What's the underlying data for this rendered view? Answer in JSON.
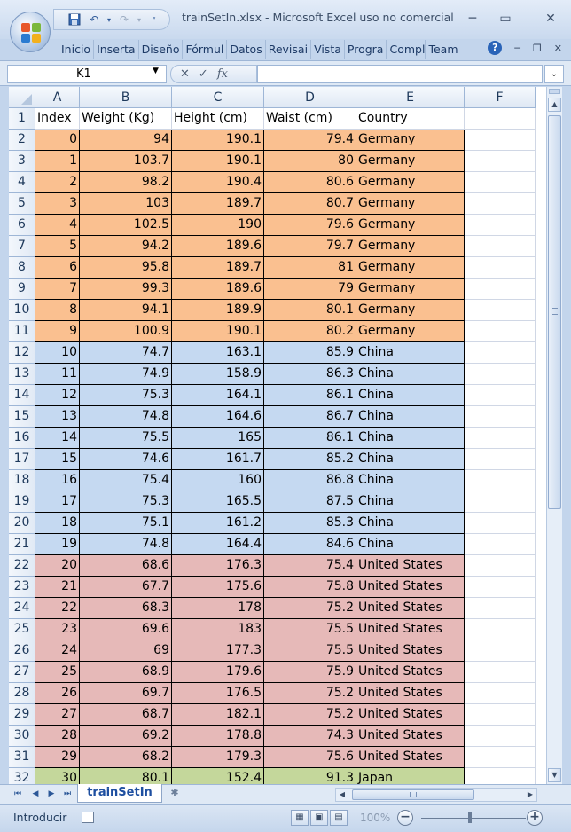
{
  "window": {
    "title": "trainSetIn.xlsx - Microsoft Excel uso no comercial",
    "minimize": "─",
    "maximize": "▭",
    "close": "✕"
  },
  "ribbon": {
    "tabs": [
      "Inicio",
      "Inserta",
      "Diseño",
      "Fórmul",
      "Datos",
      "Revisai",
      "Vista",
      "Progra",
      "Compl",
      "Team"
    ]
  },
  "formula_bar": {
    "name_box": "K1",
    "formula": ""
  },
  "sheet": {
    "columns": [
      "A",
      "B",
      "C",
      "D",
      "E",
      "F"
    ],
    "headers": [
      "Index",
      "Weight (Kg)",
      "Height (cm)",
      "Waist (cm)",
      "Country"
    ],
    "rows": [
      {
        "n": "2",
        "cells": [
          "0",
          "94",
          "190.1",
          "79.4",
          "Germany"
        ],
        "group": "de"
      },
      {
        "n": "3",
        "cells": [
          "1",
          "103.7",
          "190.1",
          "80",
          "Germany"
        ],
        "group": "de"
      },
      {
        "n": "4",
        "cells": [
          "2",
          "98.2",
          "190.4",
          "80.6",
          "Germany"
        ],
        "group": "de"
      },
      {
        "n": "5",
        "cells": [
          "3",
          "103",
          "189.7",
          "80.7",
          "Germany"
        ],
        "group": "de"
      },
      {
        "n": "6",
        "cells": [
          "4",
          "102.5",
          "190",
          "79.6",
          "Germany"
        ],
        "group": "de"
      },
      {
        "n": "7",
        "cells": [
          "5",
          "94.2",
          "189.6",
          "79.7",
          "Germany"
        ],
        "group": "de"
      },
      {
        "n": "8",
        "cells": [
          "6",
          "95.8",
          "189.7",
          "81",
          "Germany"
        ],
        "group": "de"
      },
      {
        "n": "9",
        "cells": [
          "7",
          "99.3",
          "189.6",
          "79",
          "Germany"
        ],
        "group": "de"
      },
      {
        "n": "10",
        "cells": [
          "8",
          "94.1",
          "189.9",
          "80.1",
          "Germany"
        ],
        "group": "de"
      },
      {
        "n": "11",
        "cells": [
          "9",
          "100.9",
          "190.1",
          "80.2",
          "Germany"
        ],
        "group": "de"
      },
      {
        "n": "12",
        "cells": [
          "10",
          "74.7",
          "163.1",
          "85.9",
          "China"
        ],
        "group": "cn"
      },
      {
        "n": "13",
        "cells": [
          "11",
          "74.9",
          "158.9",
          "86.3",
          "China"
        ],
        "group": "cn"
      },
      {
        "n": "14",
        "cells": [
          "12",
          "75.3",
          "164.1",
          "86.1",
          "China"
        ],
        "group": "cn"
      },
      {
        "n": "15",
        "cells": [
          "13",
          "74.8",
          "164.6",
          "86.7",
          "China"
        ],
        "group": "cn"
      },
      {
        "n": "16",
        "cells": [
          "14",
          "75.5",
          "165",
          "86.1",
          "China"
        ],
        "group": "cn"
      },
      {
        "n": "17",
        "cells": [
          "15",
          "74.6",
          "161.7",
          "85.2",
          "China"
        ],
        "group": "cn"
      },
      {
        "n": "18",
        "cells": [
          "16",
          "75.4",
          "160",
          "86.8",
          "China"
        ],
        "group": "cn"
      },
      {
        "n": "19",
        "cells": [
          "17",
          "75.3",
          "165.5",
          "87.5",
          "China"
        ],
        "group": "cn"
      },
      {
        "n": "20",
        "cells": [
          "18",
          "75.1",
          "161.2",
          "85.3",
          "China"
        ],
        "group": "cn"
      },
      {
        "n": "21",
        "cells": [
          "19",
          "74.8",
          "164.4",
          "84.6",
          "China"
        ],
        "group": "cn"
      },
      {
        "n": "22",
        "cells": [
          "20",
          "68.6",
          "176.3",
          "75.4",
          "United States"
        ],
        "group": "us"
      },
      {
        "n": "23",
        "cells": [
          "21",
          "67.7",
          "175.6",
          "75.8",
          "United States"
        ],
        "group": "us"
      },
      {
        "n": "24",
        "cells": [
          "22",
          "68.3",
          "178",
          "75.2",
          "United States"
        ],
        "group": "us"
      },
      {
        "n": "25",
        "cells": [
          "23",
          "69.6",
          "183",
          "75.5",
          "United States"
        ],
        "group": "us"
      },
      {
        "n": "26",
        "cells": [
          "24",
          "69",
          "177.3",
          "75.5",
          "United States"
        ],
        "group": "us"
      },
      {
        "n": "27",
        "cells": [
          "25",
          "68.9",
          "179.6",
          "75.9",
          "United States"
        ],
        "group": "us"
      },
      {
        "n": "28",
        "cells": [
          "26",
          "69.7",
          "176.5",
          "75.2",
          "United States"
        ],
        "group": "us"
      },
      {
        "n": "29",
        "cells": [
          "27",
          "68.7",
          "182.1",
          "75.2",
          "United States"
        ],
        "group": "us"
      },
      {
        "n": "30",
        "cells": [
          "28",
          "69.2",
          "178.8",
          "74.3",
          "United States"
        ],
        "group": "us"
      },
      {
        "n": "31",
        "cells": [
          "29",
          "68.2",
          "179.3",
          "75.6",
          "United States"
        ],
        "group": "us"
      },
      {
        "n": "32",
        "cells": [
          "30",
          "80.1",
          "152.4",
          "91.3",
          "Japan"
        ],
        "group": "jp"
      }
    ],
    "group_colors": {
      "de": "#fac090",
      "cn": "#c5d9f1",
      "us": "#e6b9b8",
      "jp": "#c4d79b"
    }
  },
  "sheet_tabs": {
    "active": "trainSetIn"
  },
  "status_bar": {
    "mode": "Introducir",
    "zoom": "100%",
    "zoom_out": "−",
    "zoom_in": "+"
  },
  "icons": [
    "office-button-icon",
    "save-icon",
    "undo-icon",
    "redo-icon",
    "customize-qat-icon",
    "help-icon",
    "cancel-icon",
    "enter-icon",
    "function-icon"
  ]
}
